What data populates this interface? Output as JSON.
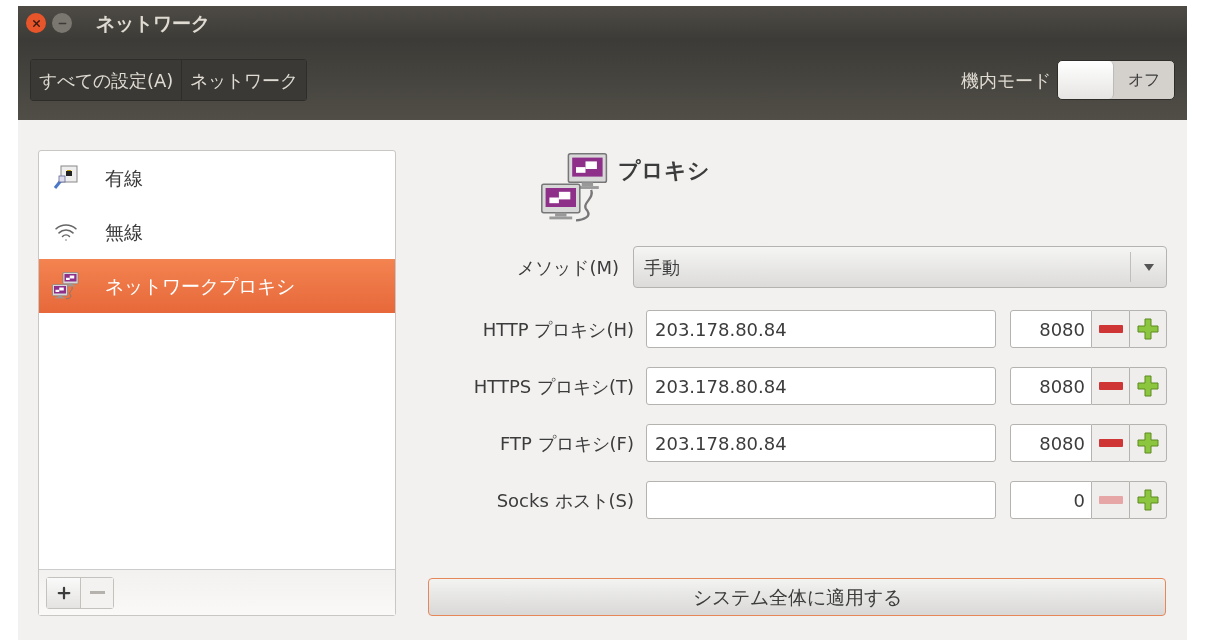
{
  "window": {
    "title": "ネットワーク"
  },
  "toolbar": {
    "breadcrumbs": [
      {
        "label": "すべての設定(A)"
      },
      {
        "label": "ネットワーク"
      }
    ],
    "airplane_mode": {
      "label": "機内モード",
      "state_text": "オフ",
      "on": false
    }
  },
  "sidebar": {
    "items": [
      {
        "label": "有線",
        "kind": "wired",
        "selected": false
      },
      {
        "label": "無線",
        "kind": "wireless",
        "selected": false
      },
      {
        "label": "ネットワークプロキシ",
        "kind": "proxy",
        "selected": true
      }
    ],
    "remove_disabled": true
  },
  "proxy": {
    "title": "プロキシ",
    "method": {
      "label": "メソッド(M)",
      "value": "手動"
    },
    "rows": [
      {
        "label": "HTTP プロキシ(H)",
        "host": "203.178.80.84",
        "port": "8080",
        "decrement_disabled": false
      },
      {
        "label": "HTTPS プロキシ(T)",
        "host": "203.178.80.84",
        "port": "8080",
        "decrement_disabled": false
      },
      {
        "label": "FTP プロキシ(F)",
        "host": "203.178.80.84",
        "port": "8080",
        "decrement_disabled": false
      },
      {
        "label": "Socks ホスト(S)",
        "host": "",
        "port": "0",
        "decrement_disabled": true
      }
    ],
    "apply_button": "システム全体に適用する"
  }
}
